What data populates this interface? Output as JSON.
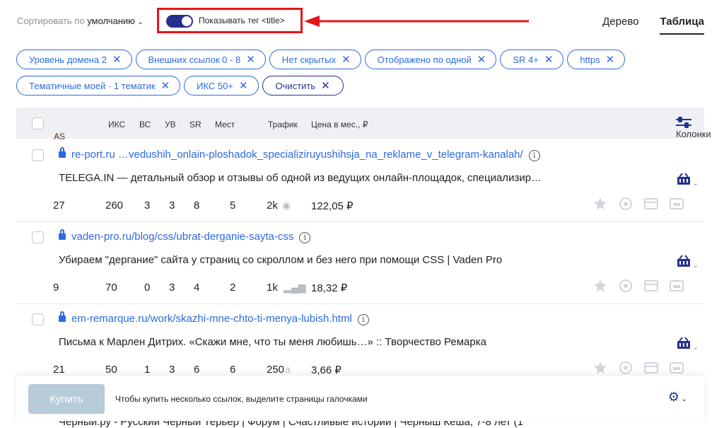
{
  "sort": {
    "prefix": "Сортировать по",
    "value": "умолчанию"
  },
  "toggle": {
    "label": "Показывать тег <title>",
    "on": true
  },
  "views": {
    "tree": "Дерево",
    "table": "Таблица"
  },
  "filters_row1": [
    "Уровень домена 2",
    "Внешних ссылок 0 - 8",
    "Нет скрытых",
    "Отображено по одной",
    "SR 4+",
    "https"
  ],
  "filters_row2": [
    "Тематичные моей · 1 тематик",
    "ИКС 50+"
  ],
  "clear_label": "Очистить",
  "columns": {
    "as": "AS",
    "iks": "ИКС",
    "vs": "ВС",
    "uv": "УВ",
    "sr": "SR",
    "mest": "Мест",
    "traffic": "Трафик",
    "price": "Цена в мес., ₽",
    "toggle": "Колонки"
  },
  "rows": [
    {
      "domain": "re-port.ru",
      "path": " …vedushih_onlain-ploshadok_specializiruyushihsja_na_reklame_v_telegram-kanalah/",
      "title": "TELEGA.IN — детальный обзор и отзывы об одной из ведущих онлайн-площадок, специализир…",
      "as": "27",
      "iks": "260",
      "vs": "3",
      "uv": "3",
      "sr": "8",
      "mest": "5",
      "traffic": "2k",
      "price": "122,05 ₽"
    },
    {
      "domain": "vaden-pro.ru",
      "path": "/blog/css/ubrat-derganie-sayta-css",
      "title": "Убираем \"дергание\" сайта у страниц со скроллом и без него при помощи CSS | Vaden Pro",
      "as": "9",
      "iks": "70",
      "vs": "0",
      "uv": "3",
      "sr": "4",
      "mest": "2",
      "traffic": "1k",
      "price": "18,32 ₽"
    },
    {
      "domain": "em-remarque.ru",
      "path": "/work/skazhi-mne-chto-ti-menya-lubish.html",
      "title": "Письма к Марлен Дитрих. «Скажи мне, что ты меня любишь…» :: Творчество Ремарка",
      "as": "21",
      "iks": "50",
      "vs": "1",
      "uv": "3",
      "sr": "6",
      "mest": "6",
      "traffic": "250",
      "price": "3,66 ₽"
    }
  ],
  "footer": {
    "buy": "Купить",
    "text": "Чтобы купить несколько ссылок, выделите страницы галочками"
  },
  "behind_text": "Черный.ру - Русский Черный Терьер | Форум | Счастливые истории | Черныш Кеша, 7-8 лет (1"
}
